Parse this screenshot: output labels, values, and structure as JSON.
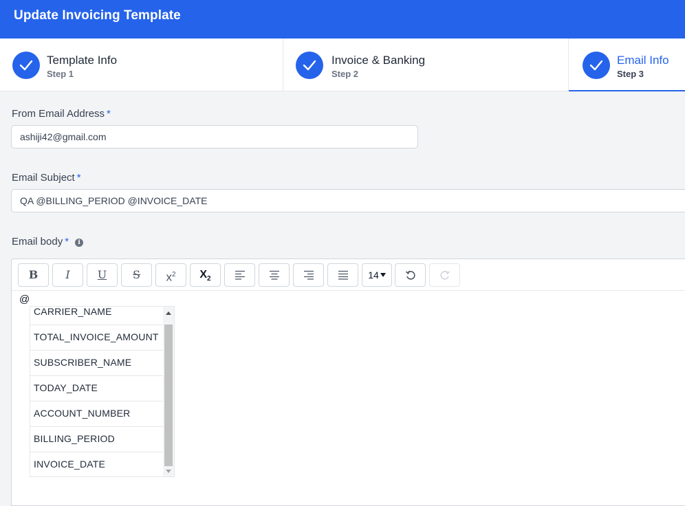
{
  "header": {
    "title": "Update Invoicing Template"
  },
  "steps": [
    {
      "name": "Template Info",
      "sub": "Step 1"
    },
    {
      "name": "Invoice & Banking",
      "sub": "Step 2"
    },
    {
      "name": "Email Info",
      "sub": "Step 3"
    }
  ],
  "form": {
    "from_label": "From Email Address",
    "from_value": "ashiji42@gmail.com",
    "subject_label": "Email Subject",
    "subject_value": "QA  @BILLING_PERIOD @INVOICE_DATE",
    "body_label": "Email body",
    "required_mark": "*",
    "info_glyph": "i"
  },
  "toolbar": {
    "bold": "B",
    "italic": "I",
    "underline": "U",
    "strike": "S",
    "superscript": "x",
    "superscript_exp": "2",
    "subscript": "X",
    "subscript_sub": "2",
    "font_size": "14"
  },
  "editor": {
    "content": "@",
    "suggestions": [
      "CARRIER_NAME",
      "TOTAL_INVOICE_AMOUNT",
      "SUBSCRIBER_NAME",
      "TODAY_DATE",
      "ACCOUNT_NUMBER",
      "BILLING_PERIOD",
      "INVOICE_DATE"
    ]
  },
  "colors": {
    "accent": "#2563eb",
    "header_bg": "#2563eb"
  },
  "icons": {
    "steps": "check-icon",
    "info": "info-icon",
    "align": [
      "align-left-icon",
      "align-center-icon",
      "align-right-icon",
      "align-justify-icon"
    ],
    "undo": "undo-icon",
    "redo": "redo-icon",
    "dropdown": "caret-down-icon"
  }
}
